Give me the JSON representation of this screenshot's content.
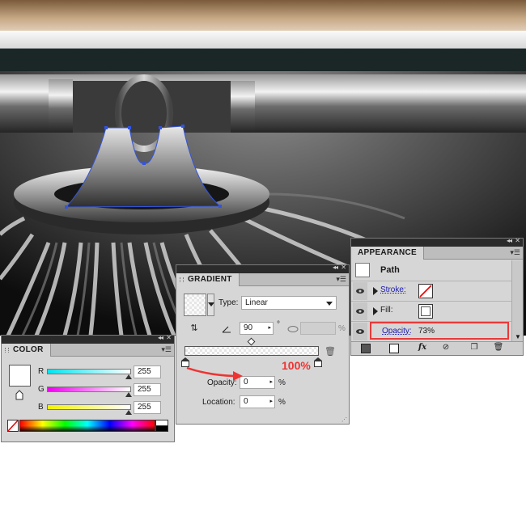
{
  "color_panel": {
    "tab": "COLOR",
    "channels": [
      {
        "letter": "R",
        "value": "255",
        "color": "#00e5f0"
      },
      {
        "letter": "G",
        "value": "255",
        "color": "#ee00ee"
      },
      {
        "letter": "B",
        "value": "255",
        "color": "#f2f200"
      }
    ]
  },
  "gradient_panel": {
    "tab": "GRADIENT",
    "type_label": "Type:",
    "type_value": "Linear",
    "angle_value": "90",
    "degree": "°",
    "pct": "%",
    "annotation": "100%",
    "opacity_label": "Opacity:",
    "opacity_value": "0",
    "location_label": "Location:",
    "location_value": "0"
  },
  "appearance_panel": {
    "tab": "APPEARANCE",
    "object_name": "Path",
    "stroke_label": "Stroke:",
    "fill_label": "Fill:",
    "opacity_label": "Opacity:",
    "opacity_value": "73%",
    "fx": "fx"
  },
  "colors": {
    "highlight_red": "#e83a3a",
    "annotation_red": "#ee3333",
    "selection_blue": "#3355dd",
    "panel_bg": "#d6d6d6"
  }
}
